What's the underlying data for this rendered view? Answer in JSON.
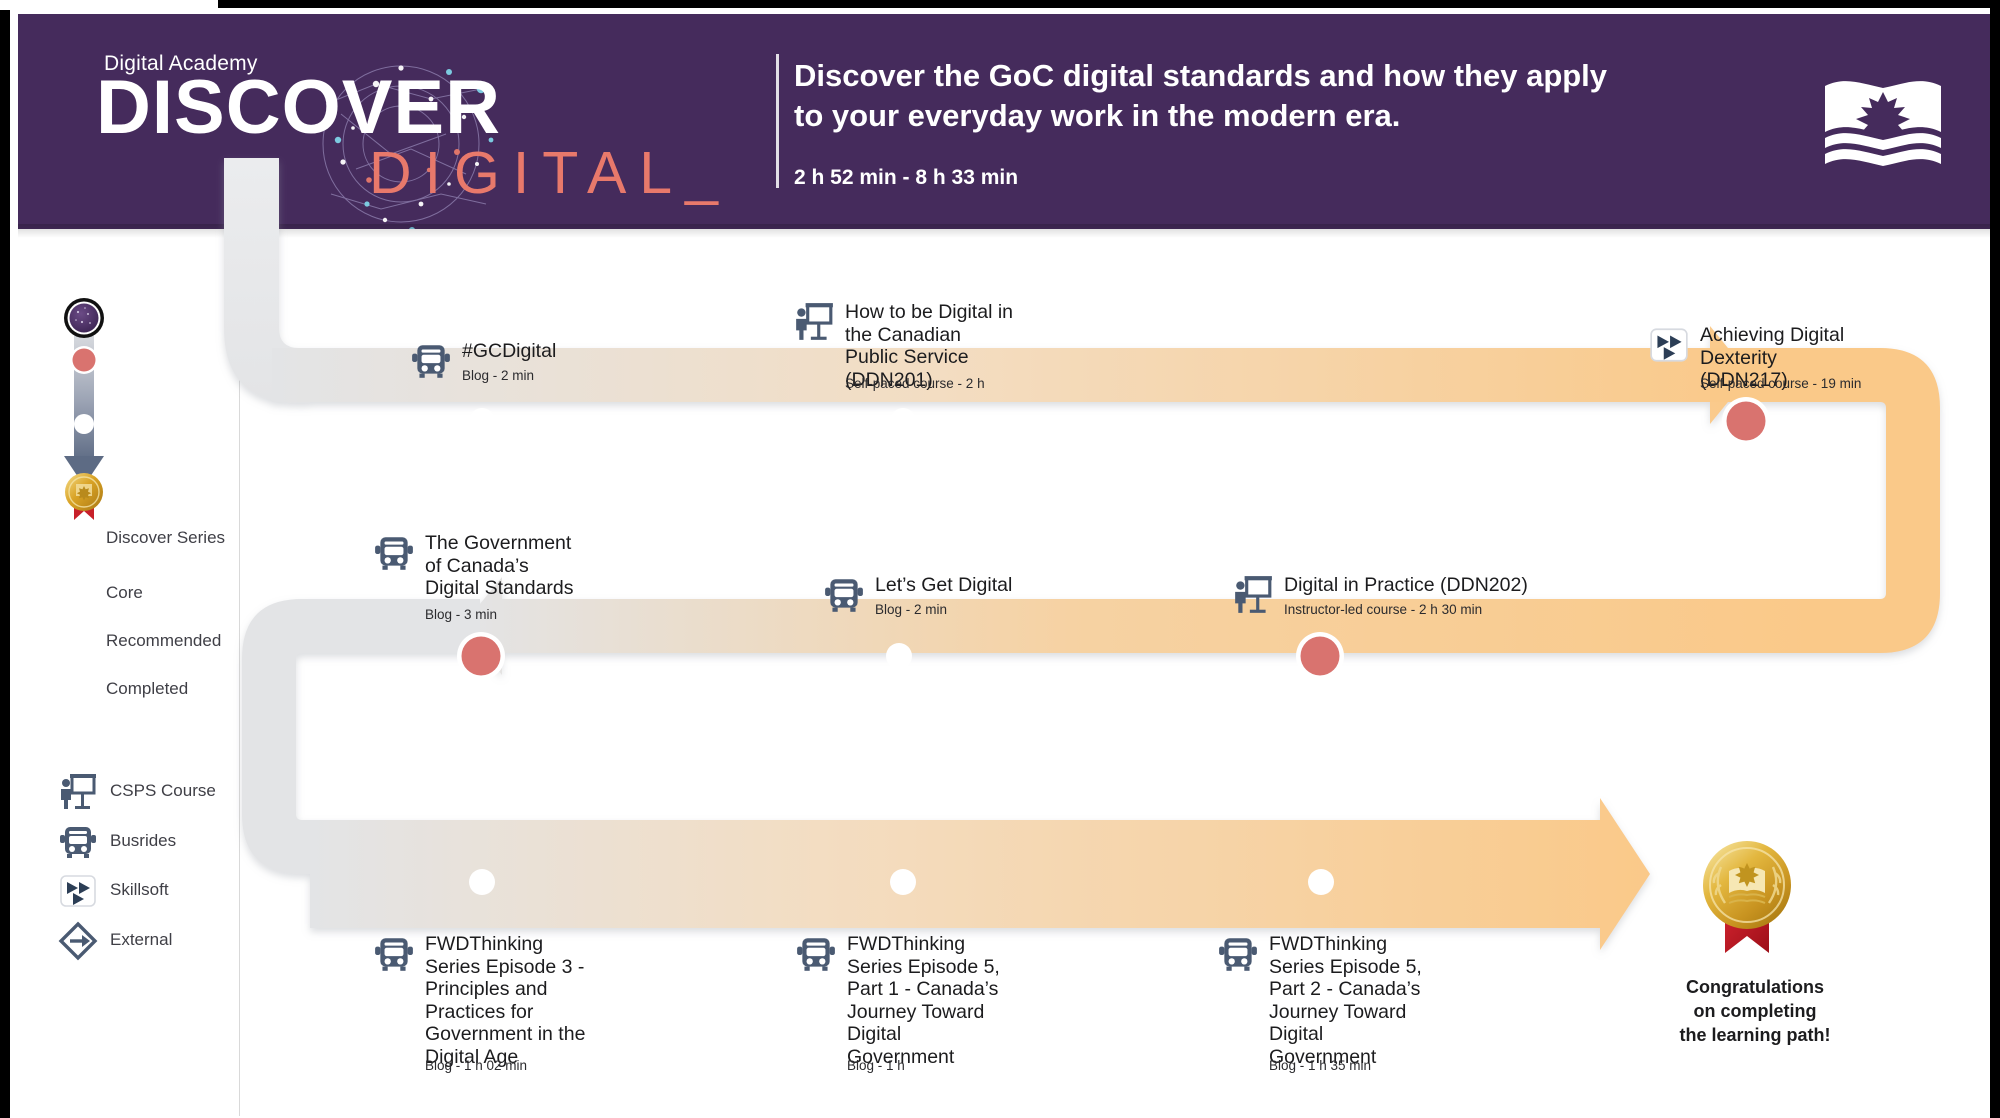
{
  "header": {
    "academy": "Digital Academy",
    "word_discover": "DISCOVER",
    "word_digital": "DIGITAL_",
    "title": "Discover the GoC digital standards and how they apply to your everyday work in the modern era.",
    "duration": "2 h 52 min - 8 h 33 min",
    "logo_name": "csps-open-book-maple-leaf-logo",
    "bg_color": "#452b5c",
    "accent_color": "#e8796b"
  },
  "legend": {
    "status": [
      {
        "label": "Discover Series",
        "icon": "discover-series-icon"
      },
      {
        "label": "Core",
        "icon": "core-dot-icon",
        "color": "#d9736f"
      },
      {
        "label": "Recommended",
        "icon": "recommended-dot-icon",
        "color": "#ffffff"
      },
      {
        "label": "Completed",
        "icon": "completed-medal-icon",
        "color": "#d9a326"
      }
    ],
    "types": [
      {
        "label": "CSPS Course",
        "icon": "csps-course-icon"
      },
      {
        "label": "Busrides",
        "icon": "busride-icon"
      },
      {
        "label": "Skillsoft",
        "icon": "skillsoft-icon"
      },
      {
        "label": "External",
        "icon": "external-link-icon"
      }
    ]
  },
  "path": {
    "core_color": "#d9736f",
    "recommended_color": "#ffffff",
    "arrow_start_color": "#e3e4e6",
    "arrow_end_color": "#fac989",
    "rows": [
      {
        "row": 1,
        "direction": "left-to-right",
        "nodes": [
          {
            "title": "#GCDigital",
            "meta": "Blog - 2 min",
            "icon": "busride-icon",
            "marker": "recommended"
          },
          {
            "title": "How to be Digital in the Canadian Public Service (DDN201)",
            "meta": "Self-paced course  - 2 h",
            "icon": "csps-course-icon",
            "marker": "recommended"
          },
          {
            "title": "Achieving Digital Dexterity (DDN217)",
            "meta": "Self-paced course - 19 min",
            "icon": "skillsoft-icon",
            "marker": "core"
          }
        ]
      },
      {
        "row": 2,
        "direction": "right-to-left",
        "nodes": [
          {
            "title": "The Government of Canada’s Digital Standards",
            "meta": "Blog - 3 min",
            "icon": "busride-icon",
            "marker": "core"
          },
          {
            "title": "Let’s Get Digital",
            "meta": "Blog - 2 min",
            "icon": "busride-icon",
            "marker": "recommended"
          },
          {
            "title": "Digital in Practice (DDN202)",
            "meta": "Instructor-led course - 2 h 30 min",
            "icon": "csps-course-icon",
            "marker": "core"
          }
        ]
      },
      {
        "row": 3,
        "direction": "left-to-right",
        "nodes": [
          {
            "title": "FWDThinking Series Episode 3 - Principles and Practices for Government in the Digital Age",
            "meta": "Blog - 1 h 02 min",
            "icon": "busride-icon",
            "marker": "recommended"
          },
          {
            "title": "FWDThinking Series Episode 5, Part 1 - Canada’s Journey Toward Digital Government",
            "meta": "Blog - 1 h",
            "icon": "busride-icon",
            "marker": "recommended"
          },
          {
            "title": "FWDThinking Series Episode 5, Part 2 - Canada’s Journey Toward Digital Government",
            "meta": "Blog - 1 h 35 min",
            "icon": "busride-icon",
            "marker": "recommended"
          }
        ]
      }
    ]
  },
  "completion": {
    "text_line1": "Congratulations",
    "text_line2": "on completing",
    "text_line3": "the learning path!",
    "badge": "completed-medal-icon"
  }
}
